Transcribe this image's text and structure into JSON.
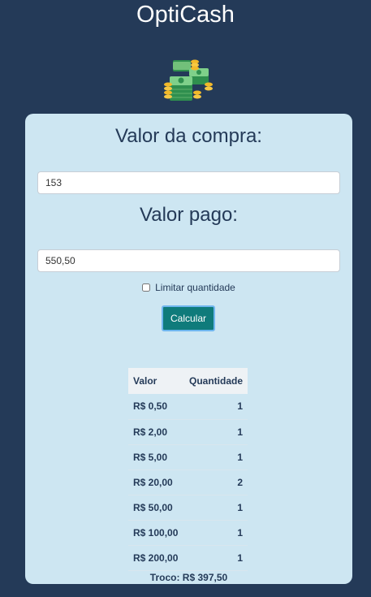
{
  "app": {
    "title": "OptiCash",
    "logo_icon": "money-stack-icon"
  },
  "form": {
    "purchase_label": "Valor da compra:",
    "purchase_value": "153",
    "paid_label": "Valor pago:",
    "paid_value": "550,50",
    "limit_checkbox_label": "Limitar quantidade",
    "limit_checked": false,
    "calculate_label": "Calcular"
  },
  "result": {
    "headers": [
      "Valor",
      "Quantidade"
    ],
    "rows": [
      {
        "value": "R$ 0,50",
        "quantity": "1"
      },
      {
        "value": "R$ 2,00",
        "quantity": "1"
      },
      {
        "value": "R$ 5,00",
        "quantity": "1"
      },
      {
        "value": "R$ 20,00",
        "quantity": "2"
      },
      {
        "value": "R$ 50,00",
        "quantity": "1"
      },
      {
        "value": "R$ 100,00",
        "quantity": "1"
      },
      {
        "value": "R$ 200,00",
        "quantity": "1"
      }
    ],
    "change_text": "Troco: R$ 397,50"
  },
  "colors": {
    "background": "#243a58",
    "card": "#cde6f2",
    "button": "#0f7b7b",
    "text": "#243a58"
  }
}
